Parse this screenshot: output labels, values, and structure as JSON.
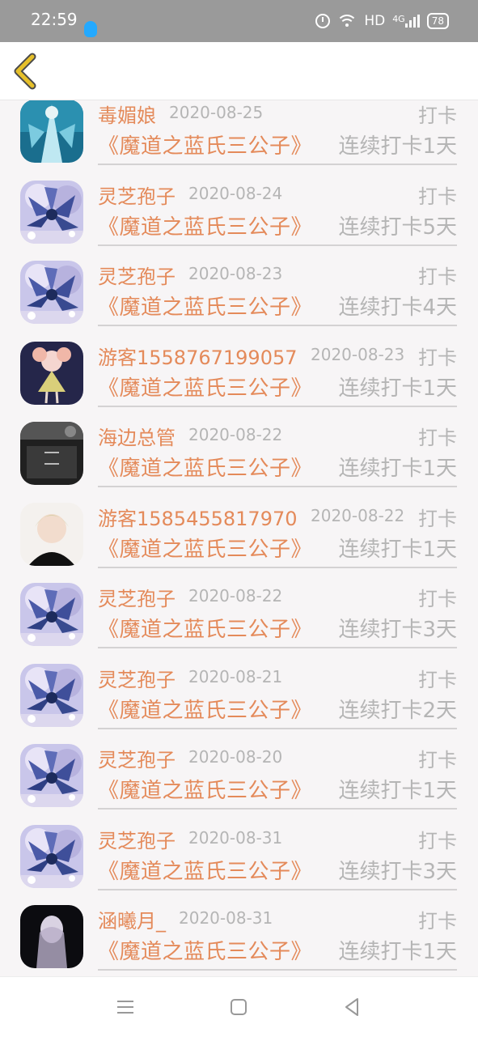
{
  "status_bar": {
    "time": "22:59",
    "network": "HD",
    "signal": "4G",
    "battery": "78",
    "icons": [
      "qq-icon",
      "alarm-icon",
      "wifi-icon",
      "signal-icon",
      "battery-icon"
    ]
  },
  "header": {
    "back_icon": "chevron-left-icon"
  },
  "colors": {
    "accent": "#e48a5a",
    "muted": "#b5b5b5",
    "back_chevron": "#c9a21c"
  },
  "checkins": [
    {
      "name": "毒媚娘",
      "date": "2020-08-25",
      "action": "打卡",
      "book": "《魔道之蓝氏三公子》",
      "streak": "连续打卡1天",
      "avatar": "ice-fairy"
    },
    {
      "name": "灵芝孢子",
      "date": "2020-08-24",
      "action": "打卡",
      "book": "《魔道之蓝氏三公子》",
      "streak": "连续打卡5天",
      "avatar": "flower"
    },
    {
      "name": "灵芝孢子",
      "date": "2020-08-23",
      "action": "打卡",
      "book": "《魔道之蓝氏三公子》",
      "streak": "连续打卡4天",
      "avatar": "flower"
    },
    {
      "name": "游客1558767199057",
      "date": "2020-08-23",
      "action": "打卡",
      "book": "《魔道之蓝氏三公子》",
      "streak": "连续打卡1天",
      "avatar": "doll"
    },
    {
      "name": "海边总管",
      "date": "2020-08-22",
      "action": "打卡",
      "book": "《魔道之蓝氏三公子》",
      "streak": "连续打卡1天",
      "avatar": "dark-text"
    },
    {
      "name": "游客1585455817970",
      "date": "2020-08-22",
      "action": "打卡",
      "book": "《魔道之蓝氏三公子》",
      "streak": "连续打卡1天",
      "avatar": "anime-boy"
    },
    {
      "name": "灵芝孢子",
      "date": "2020-08-22",
      "action": "打卡",
      "book": "《魔道之蓝氏三公子》",
      "streak": "连续打卡3天",
      "avatar": "flower"
    },
    {
      "name": "灵芝孢子",
      "date": "2020-08-21",
      "action": "打卡",
      "book": "《魔道之蓝氏三公子》",
      "streak": "连续打卡2天",
      "avatar": "flower"
    },
    {
      "name": "灵芝孢子",
      "date": "2020-08-20",
      "action": "打卡",
      "book": "《魔道之蓝氏三公子》",
      "streak": "连续打卡1天",
      "avatar": "flower"
    },
    {
      "name": "灵芝孢子",
      "date": "2020-08-31",
      "action": "打卡",
      "book": "《魔道之蓝氏三公子》",
      "streak": "连续打卡3天",
      "avatar": "flower"
    },
    {
      "name": "涵曦月_",
      "date": "2020-08-31",
      "action": "打卡",
      "book": "《魔道之蓝氏三公子》",
      "streak": "连续打卡1天",
      "avatar": "ghost-girl"
    }
  ],
  "nav_bar": {
    "icons": [
      "menu-icon",
      "home-icon",
      "back-triangle-icon"
    ]
  }
}
